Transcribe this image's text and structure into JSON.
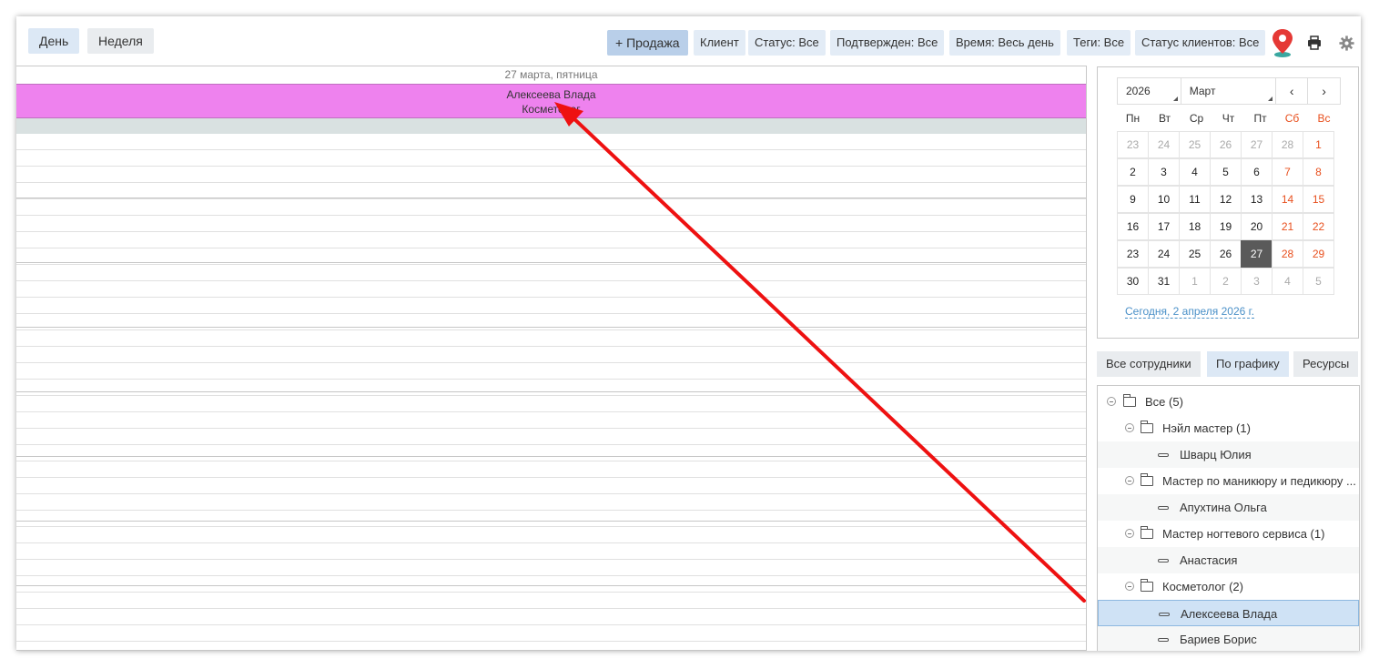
{
  "toolbar": {
    "views": [
      "День",
      "Неделя"
    ],
    "sale": "+ Продажа",
    "client": "Клиент",
    "status": "Статус: Все",
    "confirmed": "Подтвержден: Все",
    "time": "Время: Весь день",
    "tags": "Теги: Все",
    "client_status": "Статус клиентов: Все",
    "icons": [
      "location-pin-icon",
      "printer-icon",
      "gear-icon"
    ],
    "accent": "#b9cfe9"
  },
  "day_view": {
    "date_label": "27 марта, пятница",
    "resource_name": "Алексеева Влада",
    "resource_role": "Косметолог",
    "resource_color": "#ee82ee"
  },
  "calendar": {
    "year": "2026",
    "month": "Март",
    "prev": "‹",
    "next": "›",
    "weekdays": [
      "Пн",
      "Вт",
      "Ср",
      "Чт",
      "Пт",
      "Сб",
      "Вс"
    ],
    "weeks": [
      [
        "23",
        "24",
        "25",
        "26",
        "27",
        "28",
        "1"
      ],
      [
        "2",
        "3",
        "4",
        "5",
        "6",
        "7",
        "8"
      ],
      [
        "9",
        "10",
        "11",
        "12",
        "13",
        "14",
        "15"
      ],
      [
        "16",
        "17",
        "18",
        "19",
        "20",
        "21",
        "22"
      ],
      [
        "23",
        "24",
        "25",
        "26",
        "27",
        "28",
        "29"
      ],
      [
        "30",
        "31",
        "1",
        "2",
        "3",
        "4",
        "5"
      ]
    ],
    "selected_day": "27",
    "today_link": "Сегодня, 2 апреля 2026 г."
  },
  "staff_tabs": [
    "Все сотрудники",
    "По графику",
    "Ресурсы"
  ],
  "tree": [
    {
      "label": "Все (5)",
      "type": "group"
    },
    {
      "label": "Нэйл мастер  (1)",
      "type": "group"
    },
    {
      "label": "Шварц Юлия",
      "type": "employee"
    },
    {
      "label": "Мастер по маникюру и педикюру  ...",
      "type": "group"
    },
    {
      "label": "Апухтина Ольга",
      "type": "employee"
    },
    {
      "label": "Мастер ногтевого сервиса  (1)",
      "type": "group"
    },
    {
      "label": "Анастасия",
      "type": "employee"
    },
    {
      "label": "Косметолог  (2)",
      "type": "group"
    },
    {
      "label": "Алексеева Влада",
      "type": "employee",
      "selected": true
    },
    {
      "label": "Бариев Борис",
      "type": "employee"
    }
  ]
}
